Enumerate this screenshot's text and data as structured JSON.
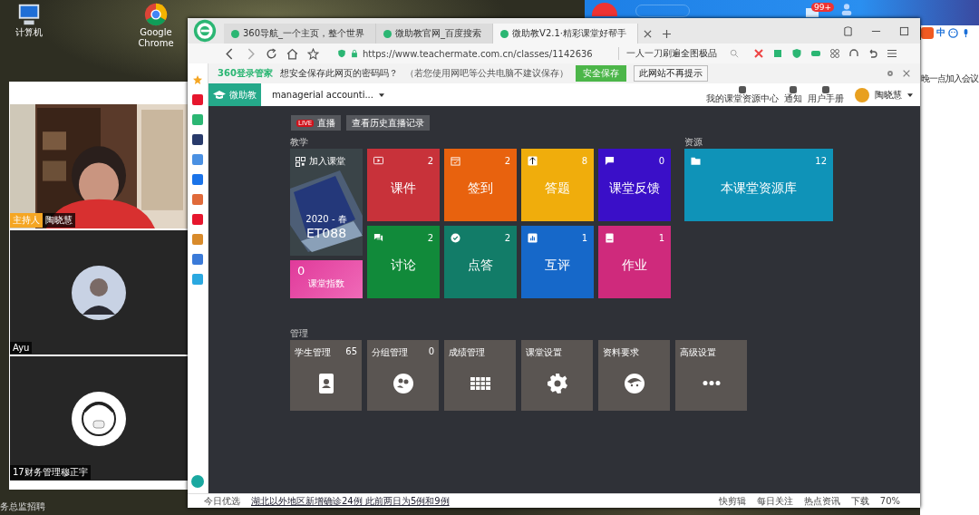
{
  "desktop_icons": [
    {
      "label": "计算机",
      "kind": "computer"
    },
    {
      "label": "Google Chrome",
      "kind": "chrome"
    }
  ],
  "desktop_bottom_label": "务总监招聘",
  "background_app": {
    "badge": "99+",
    "side_text": "晚一点加入会议"
  },
  "ime_bar": {
    "mode": "中"
  },
  "meeting": {
    "participants": [
      {
        "name": "陶晓慧",
        "role": "主持人",
        "kind": "video"
      },
      {
        "name": "Ayu",
        "kind": "photo_avatar"
      },
      {
        "name": "17财务管理穆正宇",
        "kind": "cartoon_avatar"
      }
    ]
  },
  "browser": {
    "tabs": [
      {
        "title": "360导航_一个主页，整个世界",
        "selected": false
      },
      {
        "title": "微助教官网_百度搜索",
        "selected": false
      },
      {
        "title": "微助教V2.1·精彩课堂好帮手",
        "selected": true
      }
    ],
    "url": "https://www.teachermate.com.cn/classes/1142636",
    "search": "一人一刀刷遍全图极品",
    "password_bar": {
      "brand": "360登录管家",
      "question": "想安全保存此网页的密码吗？",
      "note": "（若您使用网吧等公共电脑不建议保存）",
      "save": "安全保存",
      "never": "此网站不再提示"
    },
    "status_bar": {
      "left": "今日优选",
      "news": "湖北以外地区新增确诊24例 此前两日为5例和9例",
      "items": [
        "快剪辑",
        "每日关注",
        "热点资讯",
        "下载"
      ],
      "zoom": "70%"
    }
  },
  "app": {
    "logo": "微助教",
    "course": "managerial accounti...",
    "nav": [
      "我的课堂资源中心",
      "通知",
      "用户手册"
    ],
    "user": "陶晓慧",
    "live_badge": "LIVE",
    "live_button": "直播",
    "history_button": "查看历史直播记录",
    "teaching_label": "教学",
    "resource_label": "资源",
    "manage_label": "管理",
    "join": {
      "title": "加入课堂",
      "term": "2020 - 春",
      "code": "ET088"
    },
    "index": {
      "value": "0",
      "label": "课堂指数"
    },
    "teaching_tiles": [
      {
        "label": "课件",
        "count": "2",
        "color": "#c8323a",
        "kind": "slides"
      },
      {
        "label": "签到",
        "count": "2",
        "color": "#e8620e",
        "kind": "calendar"
      },
      {
        "label": "答题",
        "count": "8",
        "color": "#f0ad0c",
        "kind": "quiz"
      },
      {
        "label": "课堂反馈",
        "count": "0",
        "color": "#3a0fc8",
        "kind": "feedback"
      },
      {
        "label": "讨论",
        "count": "2",
        "color": "#118a3a",
        "kind": "chat"
      },
      {
        "label": "点答",
        "count": "2",
        "color": "#127c68",
        "kind": "check"
      },
      {
        "label": "互评",
        "count": "1",
        "color": "#1668c9",
        "kind": "chart"
      },
      {
        "label": "作业",
        "count": "1",
        "color": "#cf2a7c",
        "kind": "book"
      }
    ],
    "resource_tile": {
      "label": "本课堂资源库",
      "count": "12"
    },
    "manage_tiles": [
      {
        "label": "学生管理",
        "count": "65",
        "kind": "contact"
      },
      {
        "label": "分组管理",
        "count": "0",
        "kind": "group"
      },
      {
        "label": "成绩管理",
        "kind": "grid"
      },
      {
        "label": "课堂设置",
        "kind": "gear"
      },
      {
        "label": "资料要求",
        "kind": "face"
      },
      {
        "label": "高级设置",
        "kind": "dots"
      }
    ]
  }
}
